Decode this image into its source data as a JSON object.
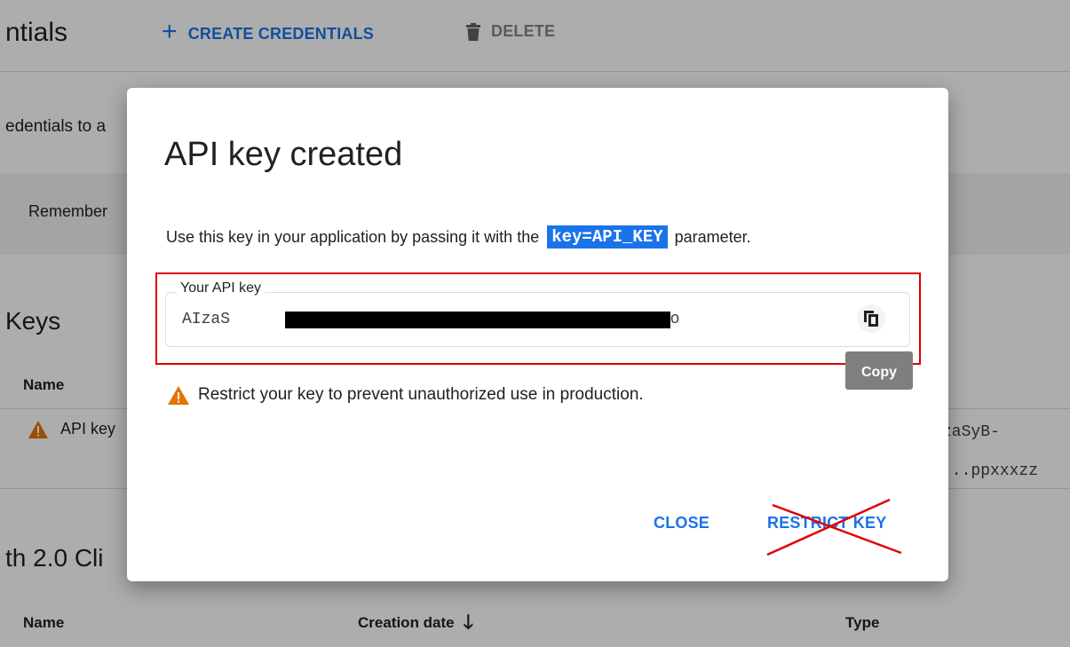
{
  "background": {
    "page_title": "ntials",
    "toolbar": {
      "create_label": "CREATE CREDENTIALS",
      "delete_label": "DELETE"
    },
    "intro_text": "edentials to a",
    "reminder_text": "Remember",
    "keys_section": {
      "heading": "Keys",
      "name_column": "Name",
      "row": {
        "name": "API key",
        "key_preview_line1": "zaSyB-",
        "key_preview_line2": "...ppxxxzz"
      }
    },
    "oauth_section": {
      "heading": "th 2.0 Cli",
      "columns": [
        "Name",
        "Creation date",
        "Type"
      ]
    }
  },
  "dialog": {
    "title": "API key created",
    "description_prefix": "Use this key in your application by passing it with the",
    "param": "key=API_KEY",
    "description_suffix": "parameter.",
    "field_label": "Your API key",
    "key_start": "AIzaS",
    "key_end": "89o",
    "copy_tooltip": "Copy",
    "warning": "Restrict your key to prevent unauthorized use in production.",
    "buttons": {
      "close": "CLOSE",
      "restrict": "RESTRICT KEY"
    }
  },
  "colors": {
    "accent": "#1a73e8",
    "warning": "#e37400",
    "annotation_red": "#e00000",
    "tooltip": "#7f7f7f"
  },
  "icons": {
    "create": "plus-icon",
    "delete": "trash-icon",
    "copy": "copy-icon",
    "warning": "warning-icon",
    "sort": "arrow-down-icon"
  }
}
